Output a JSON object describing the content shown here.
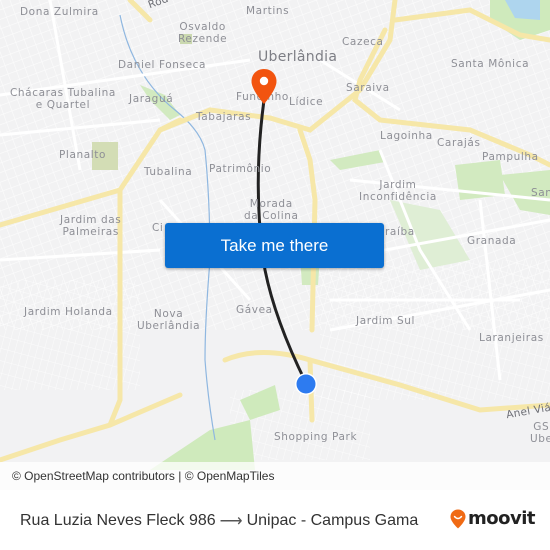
{
  "map": {
    "city_label": "Uberlândia",
    "neighborhoods": [
      {
        "id": "dona-zulmira",
        "label": "Dona Zulmira"
      },
      {
        "id": "martins",
        "label": "Martins"
      },
      {
        "id": "osvaldo-rezende",
        "label": "Osvaldo\nRezende"
      },
      {
        "id": "cazeca",
        "label": "Cazeca"
      },
      {
        "id": "daniel-fonseca",
        "label": "Daniel Fonseca"
      },
      {
        "id": "santa-monica",
        "label": "Santa Mônica"
      },
      {
        "id": "chacaras-tubalina",
        "label": "Chácaras Tubalina\ne Quartel"
      },
      {
        "id": "jaragua",
        "label": "Jaraguá"
      },
      {
        "id": "fundinho",
        "label": "Fundinho"
      },
      {
        "id": "lidice",
        "label": "Lídice"
      },
      {
        "id": "saraiva",
        "label": "Saraiva"
      },
      {
        "id": "tabajaras",
        "label": "Tabajaras"
      },
      {
        "id": "lagoinha",
        "label": "Lagoinha"
      },
      {
        "id": "carajas",
        "label": "Carajás"
      },
      {
        "id": "planalto",
        "label": "Planalto"
      },
      {
        "id": "pampulha",
        "label": "Pampulha"
      },
      {
        "id": "tubalina",
        "label": "Tubalina"
      },
      {
        "id": "patrimonio",
        "label": "Patrimônio"
      },
      {
        "id": "jardim-inconfidencia",
        "label": "Jardim\nInconfidência"
      },
      {
        "id": "santa-luzia",
        "label": "San"
      },
      {
        "id": "jardim-das-palmeiras",
        "label": "Jardim das\nPalmeiras"
      },
      {
        "id": "morada-da-colina",
        "label": "Morada\nda Colina"
      },
      {
        "id": "cidade-jardim",
        "label": "Ci"
      },
      {
        "id": "granada",
        "label": "Granada"
      },
      {
        "id": "jaraiba",
        "label": "raíba"
      },
      {
        "id": "jardim-holanda",
        "label": "Jardim Holanda"
      },
      {
        "id": "nova-uberlandia",
        "label": "Nova\nUberlândia"
      },
      {
        "id": "gavea",
        "label": "Gávea"
      },
      {
        "id": "jardim-sul",
        "label": "Jardim Sul"
      },
      {
        "id": "laranjeiras",
        "label": "Laranjeiras"
      },
      {
        "id": "shopping-park",
        "label": "Shopping Park"
      },
      {
        "id": "gs-ube",
        "label": "GS\nUbe"
      }
    ],
    "road_labels": [
      {
        "id": "anel-viario",
        "label": "Anel Viár"
      },
      {
        "id": "rodovia",
        "label": "Rod"
      }
    ],
    "destination_marker": {
      "icon": "map-pin-icon",
      "color": "#f2540f"
    },
    "origin_marker": {
      "icon": "current-location-dot-icon",
      "color": "#2d7bf0"
    },
    "route_line_color": "#222222",
    "cta_button": {
      "label": "Take me there",
      "color": "#0a6fd1"
    },
    "attribution": "© OpenStreetMap contributors | © OpenMapTiles"
  },
  "footer": {
    "origin": "Rua Luzia Neves Fleck 986",
    "arrow": "⟶",
    "destination": "Unipac - Campus Gama",
    "brand": {
      "name": "moovit",
      "color": "#f06a14"
    }
  }
}
